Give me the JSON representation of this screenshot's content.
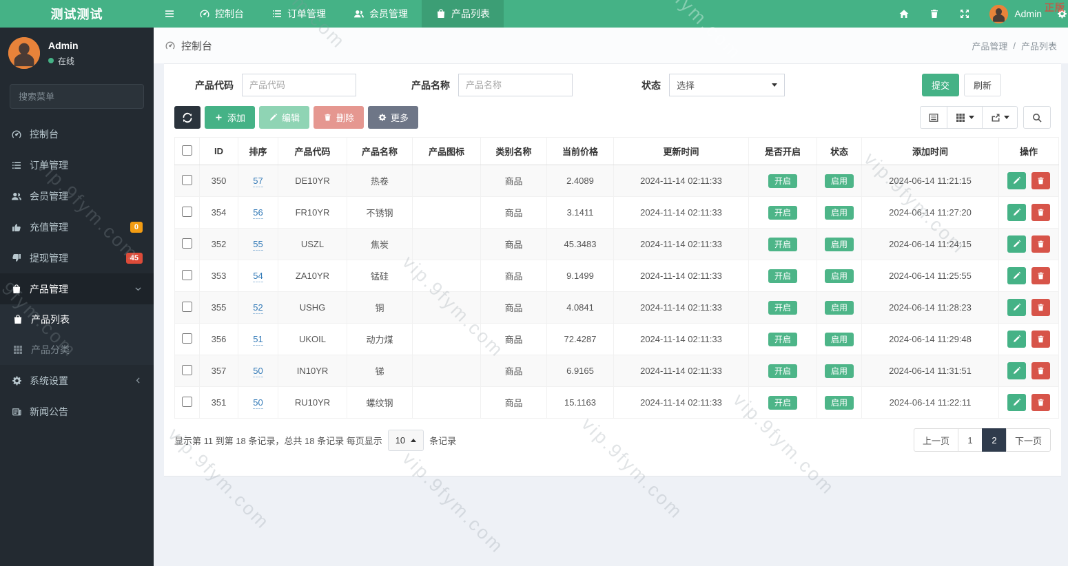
{
  "watermark": {
    "text": "vip.9fym.com",
    "corner": "正版"
  },
  "topbar": {
    "brand": "测试测试",
    "nav": [
      {
        "icon": "gauge-icon",
        "label": "控制台"
      },
      {
        "icon": "list-icon",
        "label": "订单管理"
      },
      {
        "icon": "users-icon",
        "label": "会员管理"
      },
      {
        "icon": "bag-icon",
        "label": "产品列表",
        "active": true
      }
    ],
    "user_label": "Admin"
  },
  "sidebar": {
    "user": {
      "name": "Admin",
      "status": "在线"
    },
    "search_placeholder": "搜索菜单",
    "items": [
      {
        "icon": "gauge-icon",
        "label": "控制台"
      },
      {
        "icon": "list-icon",
        "label": "订单管理"
      },
      {
        "icon": "users-icon",
        "label": "会员管理"
      },
      {
        "icon": "thumb-up-icon",
        "label": "充值管理",
        "badge": "0"
      },
      {
        "icon": "thumb-down-icon",
        "label": "提现管理",
        "badge": "45"
      },
      {
        "icon": "bag-icon",
        "label": "产品管理",
        "children": [
          {
            "icon": "bag-icon",
            "label": "产品列表",
            "active": true
          },
          {
            "icon": "grid-icon",
            "label": "产品分类"
          }
        ]
      },
      {
        "icon": "gears-icon",
        "label": "系统设置"
      },
      {
        "icon": "newspaper-icon",
        "label": "新闻公告"
      }
    ]
  },
  "breadcrumb": {
    "home": "控制台",
    "trail": [
      "产品管理",
      "产品列表"
    ]
  },
  "filters": {
    "code": {
      "label": "产品代码",
      "placeholder": "产品代码",
      "value": ""
    },
    "name": {
      "label": "产品名称",
      "placeholder": "产品名称",
      "value": ""
    },
    "status": {
      "label": "状态",
      "value": "选择"
    },
    "submit_label": "提交",
    "refresh_label": "刷新"
  },
  "toolbar": {
    "add_label": "添加",
    "edit_label": "编辑",
    "delete_label": "删除",
    "more_label": "更多"
  },
  "table": {
    "columns": [
      "ID",
      "排序",
      "产品代码",
      "产品名称",
      "产品图标",
      "类别名称",
      "当前价格",
      "更新时间",
      "是否开启",
      "状态",
      "添加时间",
      "操作"
    ],
    "rows": [
      {
        "id": "350",
        "sort": "57",
        "code": "DE10YR",
        "name": "热卷",
        "icon": "",
        "category": "商品",
        "price": "2.4089",
        "updated": "2024-11-14 02:11:33",
        "open": "开启",
        "status": "启用",
        "added": "2024-06-14 11:21:15"
      },
      {
        "id": "354",
        "sort": "56",
        "code": "FR10YR",
        "name": "不锈钢",
        "icon": "",
        "category": "商品",
        "price": "3.1411",
        "updated": "2024-11-14 02:11:33",
        "open": "开启",
        "status": "启用",
        "added": "2024-06-14 11:27:20"
      },
      {
        "id": "352",
        "sort": "55",
        "code": "USZL",
        "name": "焦炭",
        "icon": "",
        "category": "商品",
        "price": "45.3483",
        "updated": "2024-11-14 02:11:33",
        "open": "开启",
        "status": "启用",
        "added": "2024-06-14 11:24:15"
      },
      {
        "id": "353",
        "sort": "54",
        "code": "ZA10YR",
        "name": "锰硅",
        "icon": "",
        "category": "商品",
        "price": "9.1499",
        "updated": "2024-11-14 02:11:33",
        "open": "开启",
        "status": "启用",
        "added": "2024-06-14 11:25:55"
      },
      {
        "id": "355",
        "sort": "52",
        "code": "USHG",
        "name": "铜",
        "icon": "",
        "category": "商品",
        "price": "4.0841",
        "updated": "2024-11-14 02:11:33",
        "open": "开启",
        "status": "启用",
        "added": "2024-06-14 11:28:23"
      },
      {
        "id": "356",
        "sort": "51",
        "code": "UKOIL",
        "name": "动力煤",
        "icon": "",
        "category": "商品",
        "price": "72.4287",
        "updated": "2024-11-14 02:11:33",
        "open": "开启",
        "status": "启用",
        "added": "2024-06-14 11:29:48"
      },
      {
        "id": "357",
        "sort": "50",
        "code": "IN10YR",
        "name": "锑",
        "icon": "",
        "category": "商品",
        "price": "6.9165",
        "updated": "2024-11-14 02:11:33",
        "open": "开启",
        "status": "启用",
        "added": "2024-06-14 11:31:51"
      },
      {
        "id": "351",
        "sort": "50",
        "code": "RU10YR",
        "name": "螺纹钢",
        "icon": "",
        "category": "商品",
        "price": "15.1163",
        "updated": "2024-11-14 02:11:33",
        "open": "开启",
        "status": "启用",
        "added": "2024-06-14 11:22:11"
      }
    ]
  },
  "footer": {
    "summary_prefix": "显示第 11 到第 18 条记录，总共 18 条记录 每页显示",
    "page_size": "10",
    "summary_suffix": "条记录",
    "prev_label": "上一页",
    "pages": [
      "1",
      "2"
    ],
    "active_page": "2",
    "next_label": "下一页"
  },
  "colors": {
    "navbar_green": "#45b286",
    "nav_active_green": "#3c9e75",
    "sidebar_dark": "#232a31",
    "badge_orange": "#f39c12",
    "badge_red": "#dd4b39",
    "tag_green": "#4db588",
    "delete_red": "#d75449",
    "pagination_active": "#2f3b4c"
  }
}
